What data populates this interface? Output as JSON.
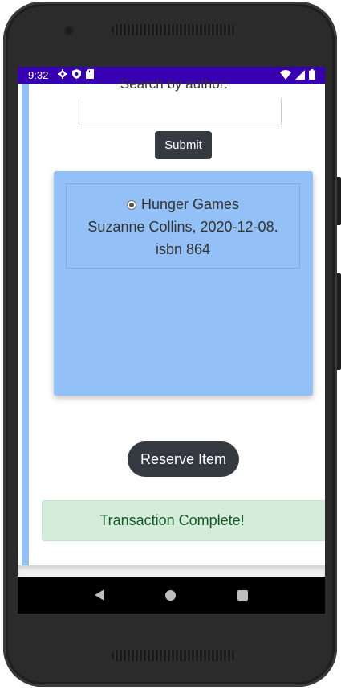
{
  "status_bar": {
    "time": "9:32"
  },
  "search": {
    "label": "Search by author:",
    "value": ""
  },
  "submit_label": "Submit",
  "results": [
    {
      "title": "Hunger Games",
      "author_date": "Suzanne Collins, 2020-12-08.",
      "isbn": "isbn 864",
      "selected": true
    }
  ],
  "reserve_label": "Reserve Item",
  "alert_text": "Transaction Complete!",
  "colors": {
    "status_bar": "#3700b3",
    "accent_blue": "#93c0f6",
    "button_dark": "#343a40",
    "success_bg": "#d4edda",
    "success_text": "#155724"
  }
}
